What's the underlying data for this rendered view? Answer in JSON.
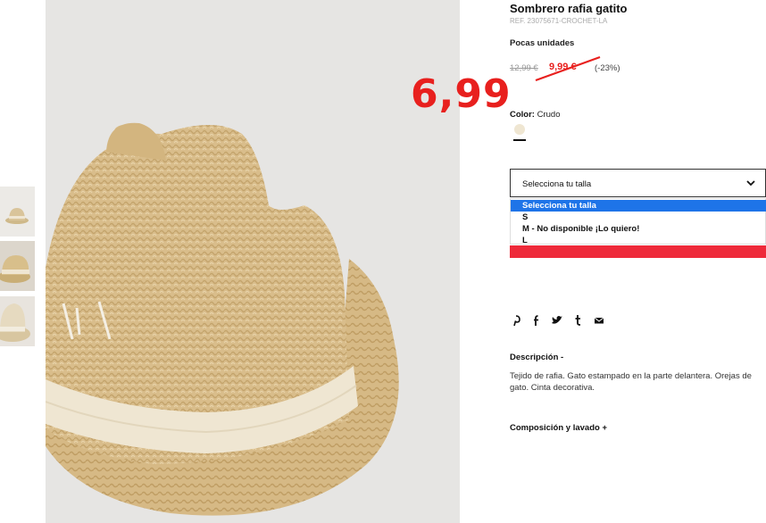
{
  "product": {
    "title": "Sombrero rafia gatito",
    "reference": "REF. 23075671-CROCHET-LA",
    "stock_status": "Pocas unidades",
    "old_price": "12,99 €",
    "new_price": "9,99 €",
    "discount": "(-23%)",
    "annotated_price": "6,99"
  },
  "color": {
    "label": "Color:",
    "value": "Crudo",
    "swatch_hex": "#efe6d2"
  },
  "size_select": {
    "label": "Selecciona tu talla",
    "options": [
      "Selecciona tu talla",
      "S",
      "M - No disponible ¡Lo quiero!",
      "L"
    ],
    "selected_index": 0
  },
  "share_icons": [
    "pinterest-icon",
    "facebook-icon",
    "twitter-icon",
    "tumblr-icon",
    "email-icon"
  ],
  "description": {
    "heading": "Descripción  -",
    "text": "Tejido de rafia. Gato estampado en la parte delantera. Orejas de gato. Cinta decorativa."
  },
  "composition": {
    "heading": "Composición y lavado  +"
  },
  "colors": {
    "sale_red": "#e8201e",
    "select_highlight": "#1e74e8",
    "bar_red": "#ee2a3a",
    "image_bg": "#e6e5e3"
  }
}
